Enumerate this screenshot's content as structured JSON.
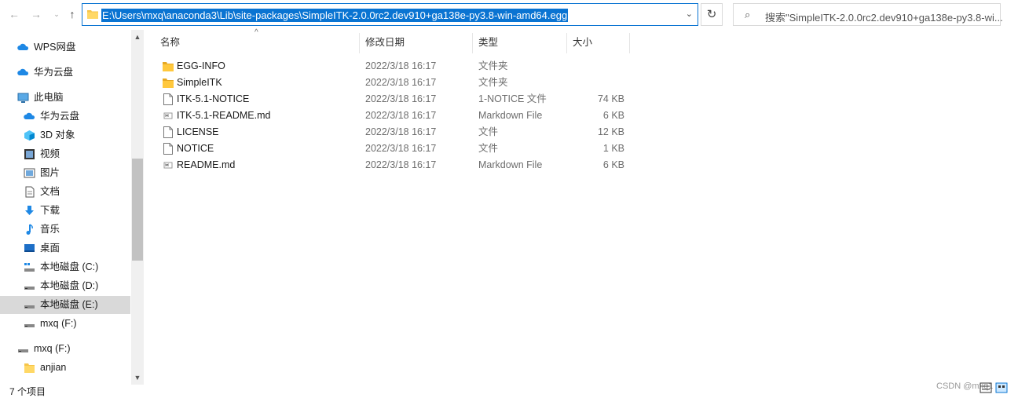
{
  "nav": {
    "back": "←",
    "forward": "→",
    "recent": "⌄",
    "up": "↑"
  },
  "address": {
    "path": "E:\\Users\\mxq\\anaconda3\\Lib\\site-packages\\SimpleITK-2.0.0rc2.dev910+ga138e-py3.8-win-amd64.egg",
    "dropdown": "⌄"
  },
  "refresh": "↻",
  "search": {
    "icon": "⌕",
    "placeholder": "搜索\"SimpleITK-2.0.0rc2.dev910+ga138e-py3.8-wi..."
  },
  "sidebar": {
    "items": [
      {
        "label": "WPS网盘",
        "icon": "cloud-icon"
      },
      {
        "label": "华为云盘",
        "icon": "cloud-icon"
      },
      {
        "label": "此电脑",
        "icon": "computer-icon"
      },
      {
        "label": "华为云盘",
        "icon": "cloud-icon"
      },
      {
        "label": "3D 对象",
        "icon": "cube-icon"
      },
      {
        "label": "视频",
        "icon": "video-icon"
      },
      {
        "label": "图片",
        "icon": "picture-icon"
      },
      {
        "label": "文档",
        "icon": "document-icon"
      },
      {
        "label": "下载",
        "icon": "download-icon"
      },
      {
        "label": "音乐",
        "icon": "music-icon"
      },
      {
        "label": "桌面",
        "icon": "desktop-icon"
      },
      {
        "label": "本地磁盘 (C:)",
        "icon": "drive-icon"
      },
      {
        "label": "本地磁盘 (D:)",
        "icon": "drive-icon"
      },
      {
        "label": "本地磁盘 (E:)",
        "icon": "drive-icon"
      },
      {
        "label": "mxq (F:)",
        "icon": "drive-icon"
      },
      {
        "label": "mxq (F:)",
        "icon": "drive-icon"
      },
      {
        "label": "anjian",
        "icon": "folder-icon"
      }
    ],
    "selected_index": 13
  },
  "columns": {
    "name": "名称",
    "date": "修改日期",
    "type": "类型",
    "size": "大小"
  },
  "files": [
    {
      "name": "EGG-INFO",
      "date": "2022/3/18 16:17",
      "type": "文件夹",
      "size": "",
      "icon": "folder-icon"
    },
    {
      "name": "SimpleITK",
      "date": "2022/3/18 16:17",
      "type": "文件夹",
      "size": "",
      "icon": "folder-icon"
    },
    {
      "name": "ITK-5.1-NOTICE",
      "date": "2022/3/18 16:17",
      "type": "1-NOTICE 文件",
      "size": "74 KB",
      "icon": "file-icon"
    },
    {
      "name": "ITK-5.1-README.md",
      "date": "2022/3/18 16:17",
      "type": "Markdown File",
      "size": "6 KB",
      "icon": "markdown-file-icon"
    },
    {
      "name": "LICENSE",
      "date": "2022/3/18 16:17",
      "type": "文件",
      "size": "12 KB",
      "icon": "file-icon"
    },
    {
      "name": "NOTICE",
      "date": "2022/3/18 16:17",
      "type": "文件",
      "size": "1 KB",
      "icon": "file-icon"
    },
    {
      "name": "README.md",
      "date": "2022/3/18 16:17",
      "type": "Markdown File",
      "size": "6 KB",
      "icon": "markdown-file-icon"
    }
  ],
  "status": {
    "count": "7 个项目"
  },
  "watermark": "CSDN @mxq1",
  "colors": {
    "accent": "#0a74d2",
    "folder": "#f6c54a",
    "selected_row": "#d9d9d9"
  }
}
